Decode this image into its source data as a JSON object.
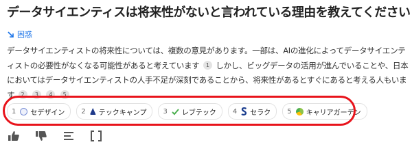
{
  "question": {
    "title": "データサイエンティスは将来性がないと言われている理由を教えてください"
  },
  "tag": {
    "label": "困惑",
    "color": "#1a73e8"
  },
  "answer": {
    "part1": "データサイエンティストの将来性については、複数の意見があります。一部は、AIの進化によってデータサイエンティストの必要性がなくなる可能性があると考えています",
    "part2": "しかし、ビッグデータの活用が進んでいることや、日本においてはデータサイエンティストの人手不足が深刻であることから、将来性があるとすぐにあると考える人もいます",
    "part3": "。",
    "footnotes": [
      "1",
      "2",
      "3",
      "4",
      "5"
    ]
  },
  "sources": [
    {
      "num": "1",
      "label": "セデザイン",
      "icon": "globe-icon",
      "color": "#7a8fd6"
    },
    {
      "num": "2",
      "label": "テックキャンプ",
      "icon": "techcamp-logo-icon",
      "color": "#1f3a8a"
    },
    {
      "num": "3",
      "label": "レブテック",
      "icon": "checkmark-logo-icon",
      "color": "#4caf50"
    },
    {
      "num": "4",
      "label": "セラク",
      "icon": "s-logo-icon",
      "color": "#1d3f8f"
    },
    {
      "num": "5",
      "label": "キャリアガーデン",
      "icon": "leaf-logo-icon",
      "color": "#8bc34a"
    }
  ],
  "actions": [
    "thumbs-up-icon",
    "thumbs-down-icon",
    "list-icon",
    "expand-icon"
  ],
  "annotation_color": "#e8131b"
}
